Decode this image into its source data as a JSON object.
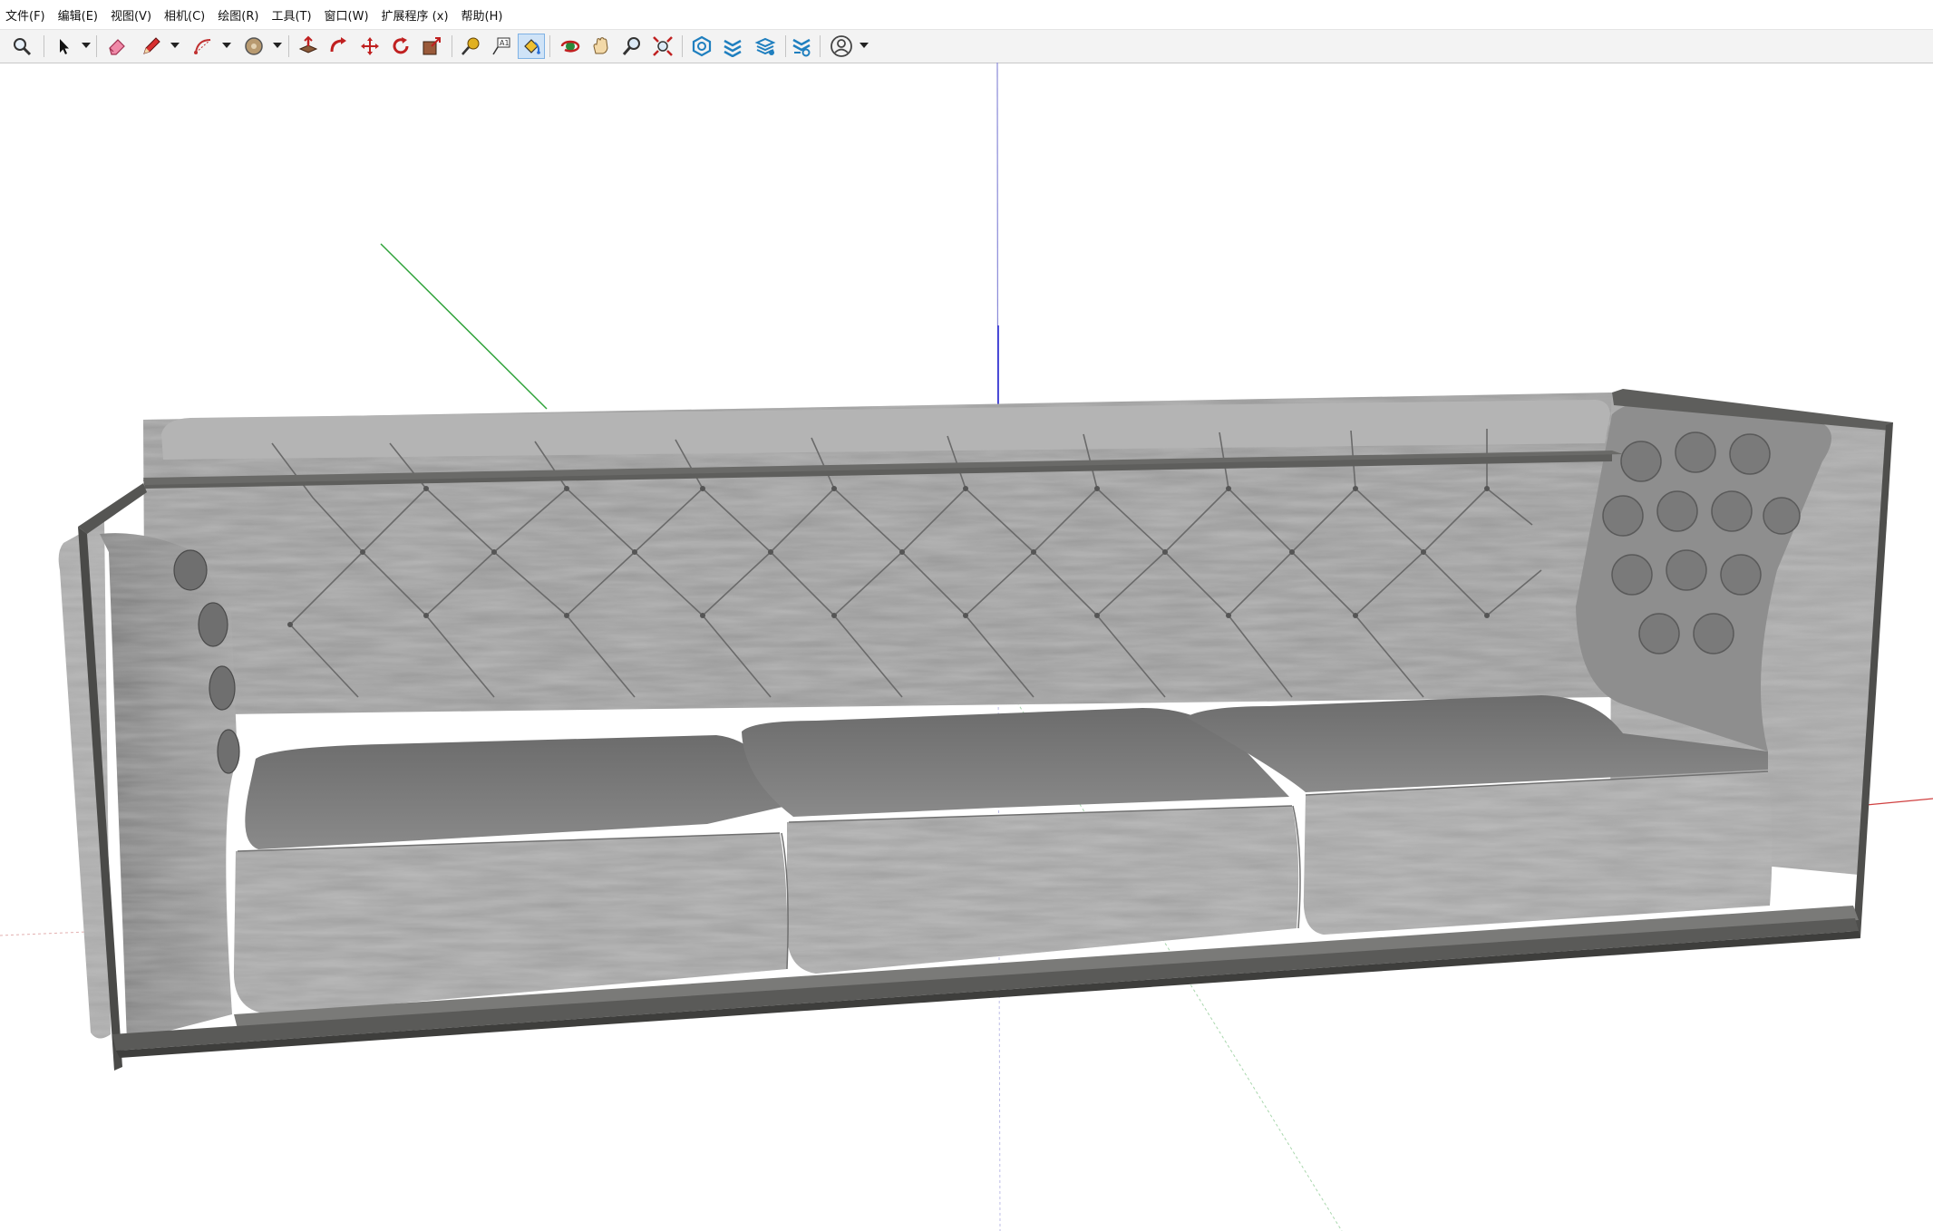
{
  "app": {
    "menu": [
      {
        "key": "file",
        "label": "文件(F)"
      },
      {
        "key": "edit",
        "label": "编辑(E)"
      },
      {
        "key": "view",
        "label": "视图(V)"
      },
      {
        "key": "camera",
        "label": "相机(C)"
      },
      {
        "key": "draw",
        "label": "绘图(R)"
      },
      {
        "key": "tools",
        "label": "工具(T)"
      },
      {
        "key": "window",
        "label": "窗口(W)"
      },
      {
        "key": "extensions",
        "label": "扩展程序 (x)"
      },
      {
        "key": "help",
        "label": "帮助(H)"
      }
    ]
  },
  "toolbar": {
    "tools": [
      {
        "icon": "search-icon",
        "active": false
      },
      {
        "icon": "select-arrow-icon",
        "active": false
      },
      {
        "icon": "eraser-icon",
        "active": false
      },
      {
        "icon": "pencil-line-icon",
        "active": false
      },
      {
        "icon": "arc-icon",
        "active": false
      },
      {
        "icon": "circle-shape-icon",
        "active": false
      },
      {
        "icon": "push-pull-icon",
        "active": false
      },
      {
        "icon": "follow-me-icon",
        "active": false
      },
      {
        "icon": "move-icon",
        "active": false
      },
      {
        "icon": "rotate-icon",
        "active": false
      },
      {
        "icon": "scale-icon",
        "active": false
      },
      {
        "icon": "tape-measure-icon",
        "active": false
      },
      {
        "icon": "text-label-icon",
        "active": false
      },
      {
        "icon": "paint-bucket-icon",
        "active": true
      },
      {
        "icon": "orbit-icon",
        "active": false
      },
      {
        "icon": "pan-icon",
        "active": false
      },
      {
        "icon": "zoom-icon",
        "active": false
      },
      {
        "icon": "zoom-extents-icon",
        "active": false
      },
      {
        "icon": "3d-warehouse-icon",
        "active": false
      },
      {
        "icon": "extension-warehouse-icon",
        "active": false
      },
      {
        "icon": "layout-icon",
        "active": false
      },
      {
        "icon": "extension-manager-icon",
        "active": false
      },
      {
        "icon": "user-account-icon",
        "active": false
      }
    ]
  },
  "colors": {
    "axis_red": "#d04040",
    "axis_green": "#2fa33a",
    "axis_blue": "#2a2ad0",
    "sofa_fabric": "#9a9a9a",
    "sofa_frame": "#5e5e5c",
    "active_tool": "#cfe3f7"
  }
}
